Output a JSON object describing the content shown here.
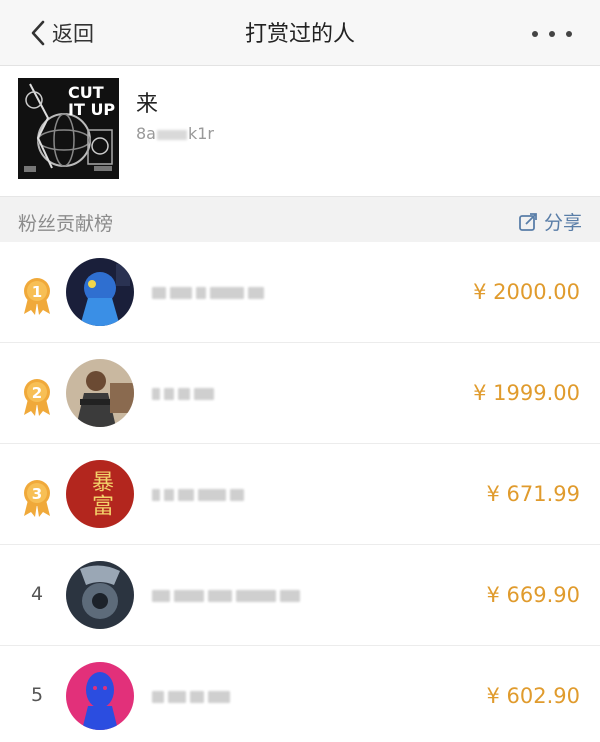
{
  "nav": {
    "back_label": "返回",
    "title": "打赏过的人",
    "more_icon": "more-dots-icon"
  },
  "profile": {
    "name": "来",
    "id_prefix": "8a",
    "id_suffix": "k1r",
    "cover_text_line1": "CUT",
    "cover_text_line2": "IT UP"
  },
  "section": {
    "title": "粉丝贡献榜",
    "share_label": "分享",
    "share_icon": "share-icon"
  },
  "colors": {
    "amount": "#e09b2d",
    "medal": "#f0a93a",
    "share": "#5a7ea8"
  },
  "ranking": [
    {
      "rank": "1",
      "medal": true,
      "amount": "¥ 2000.00",
      "avatar": "avatar-blue-figure"
    },
    {
      "rank": "2",
      "medal": true,
      "amount": "¥ 1999.00",
      "avatar": "avatar-person-photo"
    },
    {
      "rank": "3",
      "medal": true,
      "amount": "¥ 671.99",
      "avatar": "avatar-red-calligraphy",
      "avatar_text": "暴富"
    },
    {
      "rank": "4",
      "medal": false,
      "amount": "¥ 669.90",
      "avatar": "avatar-car-photo"
    },
    {
      "rank": "5",
      "medal": false,
      "amount": "¥ 602.90",
      "avatar": "avatar-blue-statue"
    }
  ]
}
